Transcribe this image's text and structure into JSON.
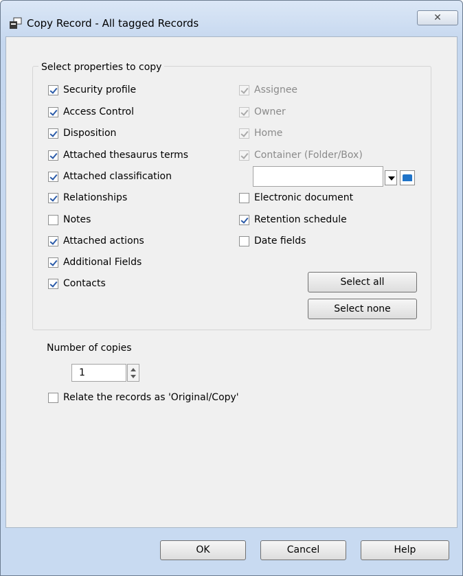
{
  "window": {
    "title": "Copy Record - All tagged Records",
    "close_glyph": "✕"
  },
  "group": {
    "legend": "Select properties to copy",
    "left_options": [
      {
        "label": "Security profile",
        "checked": true
      },
      {
        "label": "Access Control",
        "checked": true
      },
      {
        "label": "Disposition",
        "checked": true
      },
      {
        "label": "Attached thesaurus terms",
        "checked": true
      },
      {
        "label": "Attached classification",
        "checked": true
      },
      {
        "label": "Relationships",
        "checked": true
      },
      {
        "label": "Notes",
        "checked": false
      },
      {
        "label": "Attached actions",
        "checked": true
      },
      {
        "label": "Additional Fields",
        "checked": true
      },
      {
        "label": "Contacts",
        "checked": true
      }
    ],
    "right_options_disabled": [
      {
        "label": "Assignee",
        "checked": true
      },
      {
        "label": "Owner",
        "checked": true
      },
      {
        "label": "Home",
        "checked": true
      },
      {
        "label": "Container (Folder/Box)",
        "checked": true
      }
    ],
    "container_value": "",
    "right_options": [
      {
        "label": "Electronic document",
        "checked": false
      },
      {
        "label": "Retention schedule",
        "checked": true
      },
      {
        "label": "Date fields",
        "checked": false
      }
    ],
    "select_all_label": "Select all",
    "select_none_label": "Select none"
  },
  "copies": {
    "label": "Number of copies",
    "value": "1"
  },
  "relate": {
    "label": "Relate the records as 'Original/Copy'",
    "checked": false
  },
  "footer": {
    "ok_label": "OK",
    "cancel_label": "Cancel",
    "help_label": "Help"
  },
  "colors": {
    "check": "#2a5aa8",
    "folder_icon": "#1f73c8"
  }
}
